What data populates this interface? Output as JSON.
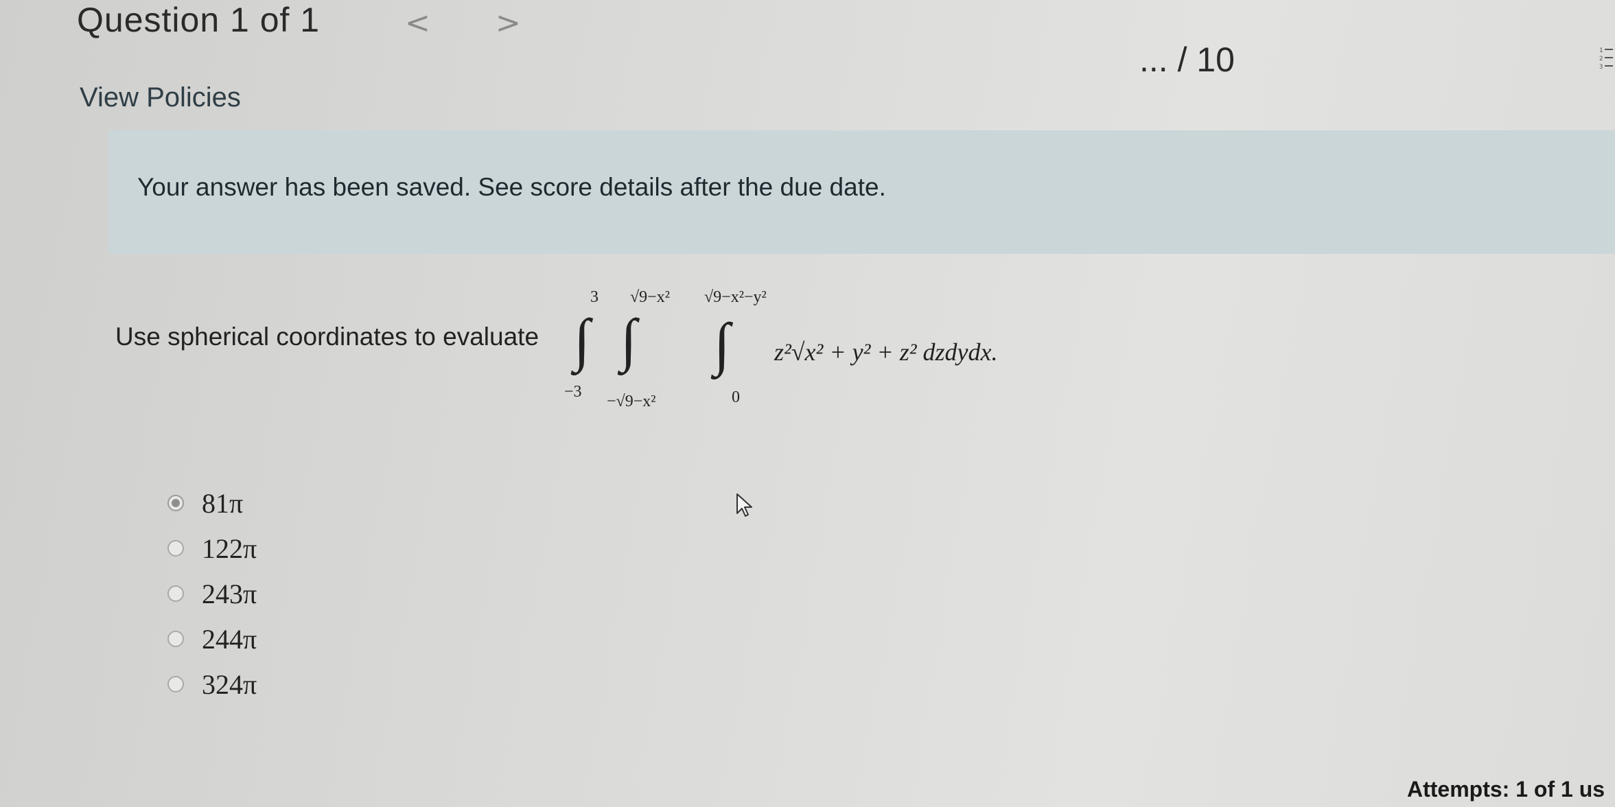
{
  "header": {
    "title": "Question 1 of 1",
    "prev_icon": "chevron-left-icon",
    "next_icon": "chevron-right-icon",
    "prev_glyph": "<",
    "next_glyph": ">",
    "score": "... / 10",
    "list_icon": "numbered-list-icon"
  },
  "links": {
    "view_policies": "View Policies"
  },
  "banner": {
    "text": "Your answer has been saved. See score details after the due date.",
    "color": "#cbd6d8"
  },
  "question": {
    "prefix": "Use spherical coordinates to evaluate",
    "integral": {
      "outer_upper": "3",
      "outer_lower": "−3",
      "middle_upper": "√9−x²",
      "middle_lower": "−√9−x²",
      "inner_upper": "√9−x²−y²",
      "inner_lower": "0",
      "integrand": "z²√x² + y² + z² dzdydx."
    }
  },
  "options": [
    {
      "label": "81π",
      "selected": true
    },
    {
      "label": "122π",
      "selected": false
    },
    {
      "label": "243π",
      "selected": false
    },
    {
      "label": "244π",
      "selected": false
    },
    {
      "label": "324π",
      "selected": false
    }
  ],
  "footer": {
    "attempts": "Attempts: 1 of 1 us"
  }
}
